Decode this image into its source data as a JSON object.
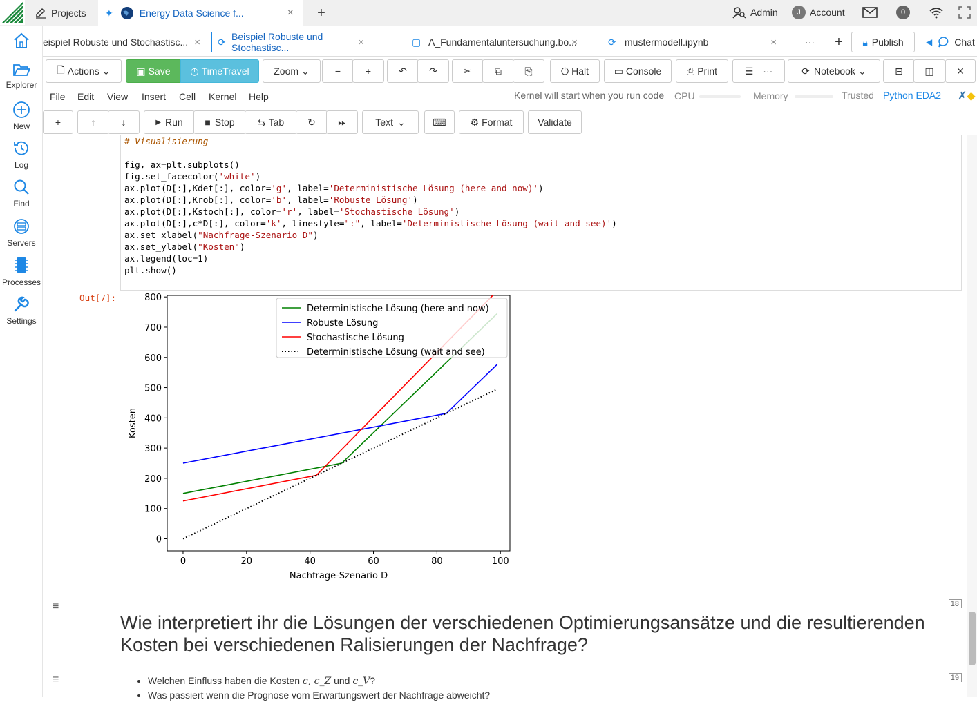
{
  "topbar": {
    "projects_label": "Projects",
    "energy_tab_label": "Energy Data Science f...",
    "admin_label": "Admin",
    "account_initial": "J",
    "account_label": "Account",
    "notifications_count": "0"
  },
  "sidebar": {
    "items": [
      {
        "label": "",
        "icon": "home-icon"
      },
      {
        "label": "Explorer",
        "icon": "folder-icon"
      },
      {
        "label": "New",
        "icon": "plus-circle-icon"
      },
      {
        "label": "Log",
        "icon": "history-icon"
      },
      {
        "label": "Find",
        "icon": "search-icon"
      },
      {
        "label": "Servers",
        "icon": "servers-icon"
      },
      {
        "label": "Processes",
        "icon": "processes-icon"
      },
      {
        "label": "Settings",
        "icon": "wrench-icon"
      }
    ]
  },
  "filetabs": {
    "tab1": "eispiel Robuste und Stochastisc...",
    "tab2": "Beispiel Robuste und Stochastisc...",
    "tab3": "A_Fundamentaluntersuchung.bo...",
    "tab4": "mustermodell.ipynb",
    "more": "···",
    "publish": "Publish",
    "chat": "Chat"
  },
  "toolbar": {
    "actions": "Actions",
    "save": "Save",
    "timetravel": "TimeTravel",
    "zoom": "Zoom",
    "halt": "Halt",
    "console": "Console",
    "print": "Print",
    "more": "···",
    "notebook": "Notebook"
  },
  "menubar": {
    "file": "File",
    "edit": "Edit",
    "view": "View",
    "insert": "Insert",
    "cell": "Cell",
    "kernel": "Kernel",
    "help": "Help",
    "kernel_status": "Kernel will start when you run code",
    "cpu": "CPU",
    "memory": "Memory",
    "trusted": "Trusted",
    "kernel_name": "Python EDA2"
  },
  "celltoolbar": {
    "run": "Run",
    "stop": "Stop",
    "tab": "Tab",
    "celltype": "Text",
    "format": "Format",
    "validate": "Validate"
  },
  "code": {
    "comment": "# Visualisierung",
    "out_prompt": "Out[7]:"
  },
  "chart_data": {
    "type": "line",
    "xlabel": "Nachfrage-Szenario D",
    "ylabel": "Kosten",
    "xlim": [
      -5,
      103
    ],
    "ylim": [
      -40,
      805
    ],
    "xticks": [
      0,
      20,
      40,
      60,
      80,
      100
    ],
    "yticks": [
      0,
      100,
      200,
      300,
      400,
      500,
      600,
      700,
      800
    ],
    "legend_position": "top-right",
    "series": [
      {
        "name": "Deterministische Lösung (here and now)",
        "color": "#008000",
        "style": "solid",
        "x": [
          0,
          50,
          99
        ],
        "y": [
          150,
          250,
          745
        ]
      },
      {
        "name": "Robuste Lösung",
        "color": "#0000ff",
        "style": "solid",
        "x": [
          0,
          83,
          99
        ],
        "y": [
          250,
          415,
          577
        ]
      },
      {
        "name": "Stochastische Lösung",
        "color": "#ff0000",
        "style": "solid",
        "x": [
          0,
          42,
          99
        ],
        "y": [
          125,
          210,
          820
        ]
      },
      {
        "name": "Deterministische Lösung (wait and see)",
        "color": "#000000",
        "style": "dotted",
        "x": [
          0,
          99
        ],
        "y": [
          0,
          495
        ]
      }
    ]
  },
  "markdown": {
    "heading": "Wie interpretiert ihr die Lösungen der verschiedenen Optimierungsansätze und die resultierenden Kosten bei verschiedenen Ralisierungen der Nachfrage?",
    "bullet1_prefix": "Welchen Einfluss haben die Kosten ",
    "bullet1_math": "c, c_Z",
    "bullet1_and": " und ",
    "bullet1_math2": "c_V",
    "bullet1_suffix": "?",
    "bullet2": "Was passiert wenn die Prognose vom Erwartungswert der Nachfrage abweicht?",
    "cell_num_1": "18",
    "cell_num_2": "19"
  }
}
